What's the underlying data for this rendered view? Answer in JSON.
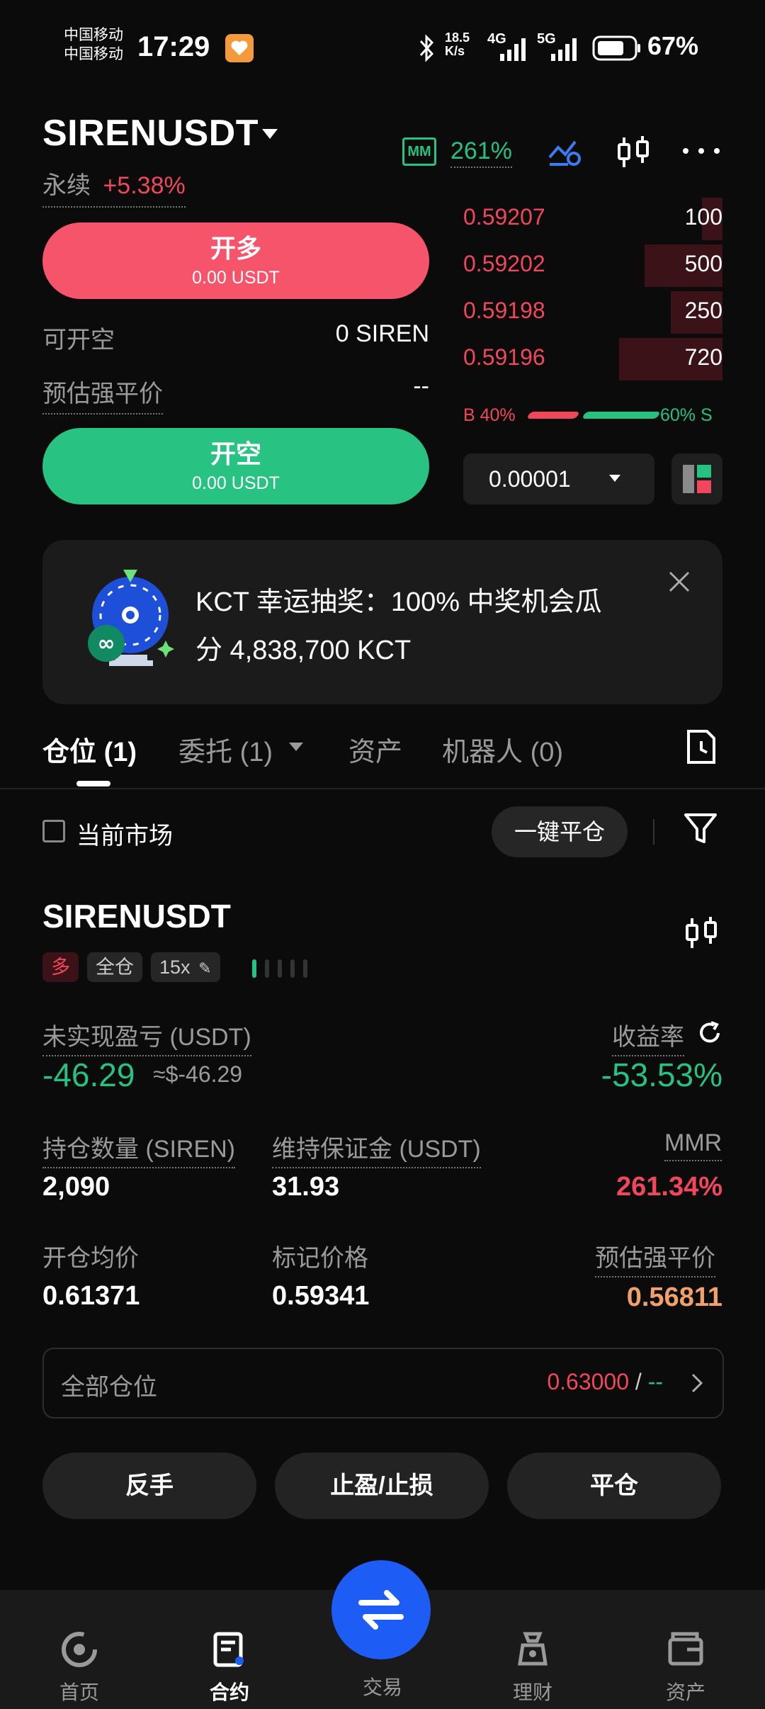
{
  "status_bar": {
    "carrier1": "中国移动",
    "carrier2": "中国移动",
    "time": "17:29",
    "net_speed_top": "18.5",
    "net_speed_bottom": "K/s",
    "net1": "4G",
    "net2": "5G",
    "battery": "67%"
  },
  "header": {
    "pair": "SIRENUSDT",
    "contract_type": "永续",
    "change": "+5.38%",
    "mm_label": "MM",
    "mm_value": "261%"
  },
  "trade": {
    "long_label": "开多",
    "long_amount": "0.00 USDT",
    "open_short_available_label": "可开空",
    "open_short_available_value": "0 SIREN",
    "est_liq_label": "预估强平价",
    "est_liq_value": "--",
    "short_label": "开空",
    "short_amount": "0.00 USDT"
  },
  "orderbook": {
    "asks": [
      {
        "price": "0.59207",
        "qty": "100",
        "depth": 0.08
      },
      {
        "price": "0.59202",
        "qty": "500",
        "depth": 0.3
      },
      {
        "price": "0.59198",
        "qty": "250",
        "depth": 0.2
      },
      {
        "price": "0.59196",
        "qty": "720",
        "depth": 0.4
      }
    ],
    "buy_ratio_label": "B 40%",
    "sell_ratio_label": "60% S",
    "buy_ratio": 0.4,
    "precision": "0.00001"
  },
  "banner": {
    "line1": "KCT 幸运抽奖：100% 中奖机会瓜",
    "line2": "分 4,838,700 KCT"
  },
  "tabs": {
    "positions": "仓位",
    "positions_count": "(1)",
    "orders": "委托",
    "orders_count": "(1)",
    "assets": "资产",
    "bots": "机器人",
    "bots_count": "(0)"
  },
  "filter": {
    "current_market": "当前市场",
    "close_all": "一键平仓"
  },
  "position": {
    "pair": "SIRENUSDT",
    "side": "多",
    "margin_mode": "全仓",
    "leverage": "15x",
    "unrealized_pnl_label": "未实现盈亏 (USDT)",
    "unrealized_pnl": "-46.29",
    "unrealized_pnl_usd": "≈$-46.29",
    "roe_label": "收益率",
    "roe": "-53.53%",
    "size_label": "持仓数量 (SIREN)",
    "size": "2,090",
    "maint_margin_label": "维持保证金 (USDT)",
    "maint_margin": "31.93",
    "mmr_label": "MMR",
    "mmr": "261.34%",
    "entry_label": "开仓均价",
    "entry": "0.61371",
    "mark_label": "标记价格",
    "mark": "0.59341",
    "liq_label": "预估强平价",
    "liq": "0.56811",
    "tpsl_row_label": "全部仓位",
    "tpsl_tp": "0.63000",
    "tpsl_sep": " / ",
    "tpsl_sl": "--",
    "reverse": "反手",
    "tp_sl": "止盈/止损",
    "close": "平仓"
  },
  "bottom_nav": {
    "home": "首页",
    "futures": "合约",
    "trade": "交易",
    "earn": "理财",
    "assets": "资产"
  },
  "colors": {
    "long": "#f5546a",
    "short": "#28c283",
    "accent_blue": "#1d5cf5"
  }
}
